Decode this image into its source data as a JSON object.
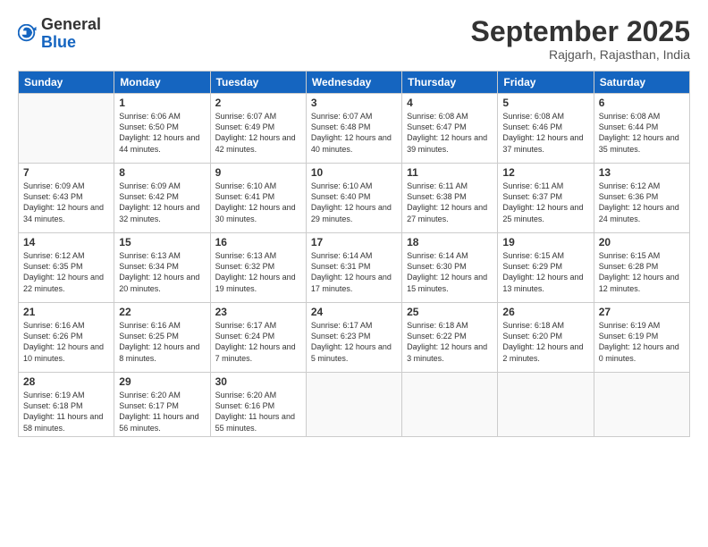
{
  "logo": {
    "general": "General",
    "blue": "Blue"
  },
  "header": {
    "month": "September 2025",
    "location": "Rajgarh, Rajasthan, India"
  },
  "weekdays": [
    "Sunday",
    "Monday",
    "Tuesday",
    "Wednesday",
    "Thursday",
    "Friday",
    "Saturday"
  ],
  "weeks": [
    [
      {
        "day": "",
        "empty": true
      },
      {
        "day": "1",
        "sunrise": "6:06 AM",
        "sunset": "6:50 PM",
        "daylight": "12 hours and 44 minutes."
      },
      {
        "day": "2",
        "sunrise": "6:07 AM",
        "sunset": "6:49 PM",
        "daylight": "12 hours and 42 minutes."
      },
      {
        "day": "3",
        "sunrise": "6:07 AM",
        "sunset": "6:48 PM",
        "daylight": "12 hours and 40 minutes."
      },
      {
        "day": "4",
        "sunrise": "6:08 AM",
        "sunset": "6:47 PM",
        "daylight": "12 hours and 39 minutes."
      },
      {
        "day": "5",
        "sunrise": "6:08 AM",
        "sunset": "6:46 PM",
        "daylight": "12 hours and 37 minutes."
      },
      {
        "day": "6",
        "sunrise": "6:08 AM",
        "sunset": "6:44 PM",
        "daylight": "12 hours and 35 minutes."
      }
    ],
    [
      {
        "day": "7",
        "sunrise": "6:09 AM",
        "sunset": "6:43 PM",
        "daylight": "12 hours and 34 minutes."
      },
      {
        "day": "8",
        "sunrise": "6:09 AM",
        "sunset": "6:42 PM",
        "daylight": "12 hours and 32 minutes."
      },
      {
        "day": "9",
        "sunrise": "6:10 AM",
        "sunset": "6:41 PM",
        "daylight": "12 hours and 30 minutes."
      },
      {
        "day": "10",
        "sunrise": "6:10 AM",
        "sunset": "6:40 PM",
        "daylight": "12 hours and 29 minutes."
      },
      {
        "day": "11",
        "sunrise": "6:11 AM",
        "sunset": "6:38 PM",
        "daylight": "12 hours and 27 minutes."
      },
      {
        "day": "12",
        "sunrise": "6:11 AM",
        "sunset": "6:37 PM",
        "daylight": "12 hours and 25 minutes."
      },
      {
        "day": "13",
        "sunrise": "6:12 AM",
        "sunset": "6:36 PM",
        "daylight": "12 hours and 24 minutes."
      }
    ],
    [
      {
        "day": "14",
        "sunrise": "6:12 AM",
        "sunset": "6:35 PM",
        "daylight": "12 hours and 22 minutes."
      },
      {
        "day": "15",
        "sunrise": "6:13 AM",
        "sunset": "6:34 PM",
        "daylight": "12 hours and 20 minutes."
      },
      {
        "day": "16",
        "sunrise": "6:13 AM",
        "sunset": "6:32 PM",
        "daylight": "12 hours and 19 minutes."
      },
      {
        "day": "17",
        "sunrise": "6:14 AM",
        "sunset": "6:31 PM",
        "daylight": "12 hours and 17 minutes."
      },
      {
        "day": "18",
        "sunrise": "6:14 AM",
        "sunset": "6:30 PM",
        "daylight": "12 hours and 15 minutes."
      },
      {
        "day": "19",
        "sunrise": "6:15 AM",
        "sunset": "6:29 PM",
        "daylight": "12 hours and 13 minutes."
      },
      {
        "day": "20",
        "sunrise": "6:15 AM",
        "sunset": "6:28 PM",
        "daylight": "12 hours and 12 minutes."
      }
    ],
    [
      {
        "day": "21",
        "sunrise": "6:16 AM",
        "sunset": "6:26 PM",
        "daylight": "12 hours and 10 minutes."
      },
      {
        "day": "22",
        "sunrise": "6:16 AM",
        "sunset": "6:25 PM",
        "daylight": "12 hours and 8 minutes."
      },
      {
        "day": "23",
        "sunrise": "6:17 AM",
        "sunset": "6:24 PM",
        "daylight": "12 hours and 7 minutes."
      },
      {
        "day": "24",
        "sunrise": "6:17 AM",
        "sunset": "6:23 PM",
        "daylight": "12 hours and 5 minutes."
      },
      {
        "day": "25",
        "sunrise": "6:18 AM",
        "sunset": "6:22 PM",
        "daylight": "12 hours and 3 minutes."
      },
      {
        "day": "26",
        "sunrise": "6:18 AM",
        "sunset": "6:20 PM",
        "daylight": "12 hours and 2 minutes."
      },
      {
        "day": "27",
        "sunrise": "6:19 AM",
        "sunset": "6:19 PM",
        "daylight": "12 hours and 0 minutes."
      }
    ],
    [
      {
        "day": "28",
        "sunrise": "6:19 AM",
        "sunset": "6:18 PM",
        "daylight": "11 hours and 58 minutes."
      },
      {
        "day": "29",
        "sunrise": "6:20 AM",
        "sunset": "6:17 PM",
        "daylight": "11 hours and 56 minutes."
      },
      {
        "day": "30",
        "sunrise": "6:20 AM",
        "sunset": "6:16 PM",
        "daylight": "11 hours and 55 minutes."
      },
      {
        "day": "",
        "empty": true
      },
      {
        "day": "",
        "empty": true
      },
      {
        "day": "",
        "empty": true
      },
      {
        "day": "",
        "empty": true
      }
    ]
  ]
}
